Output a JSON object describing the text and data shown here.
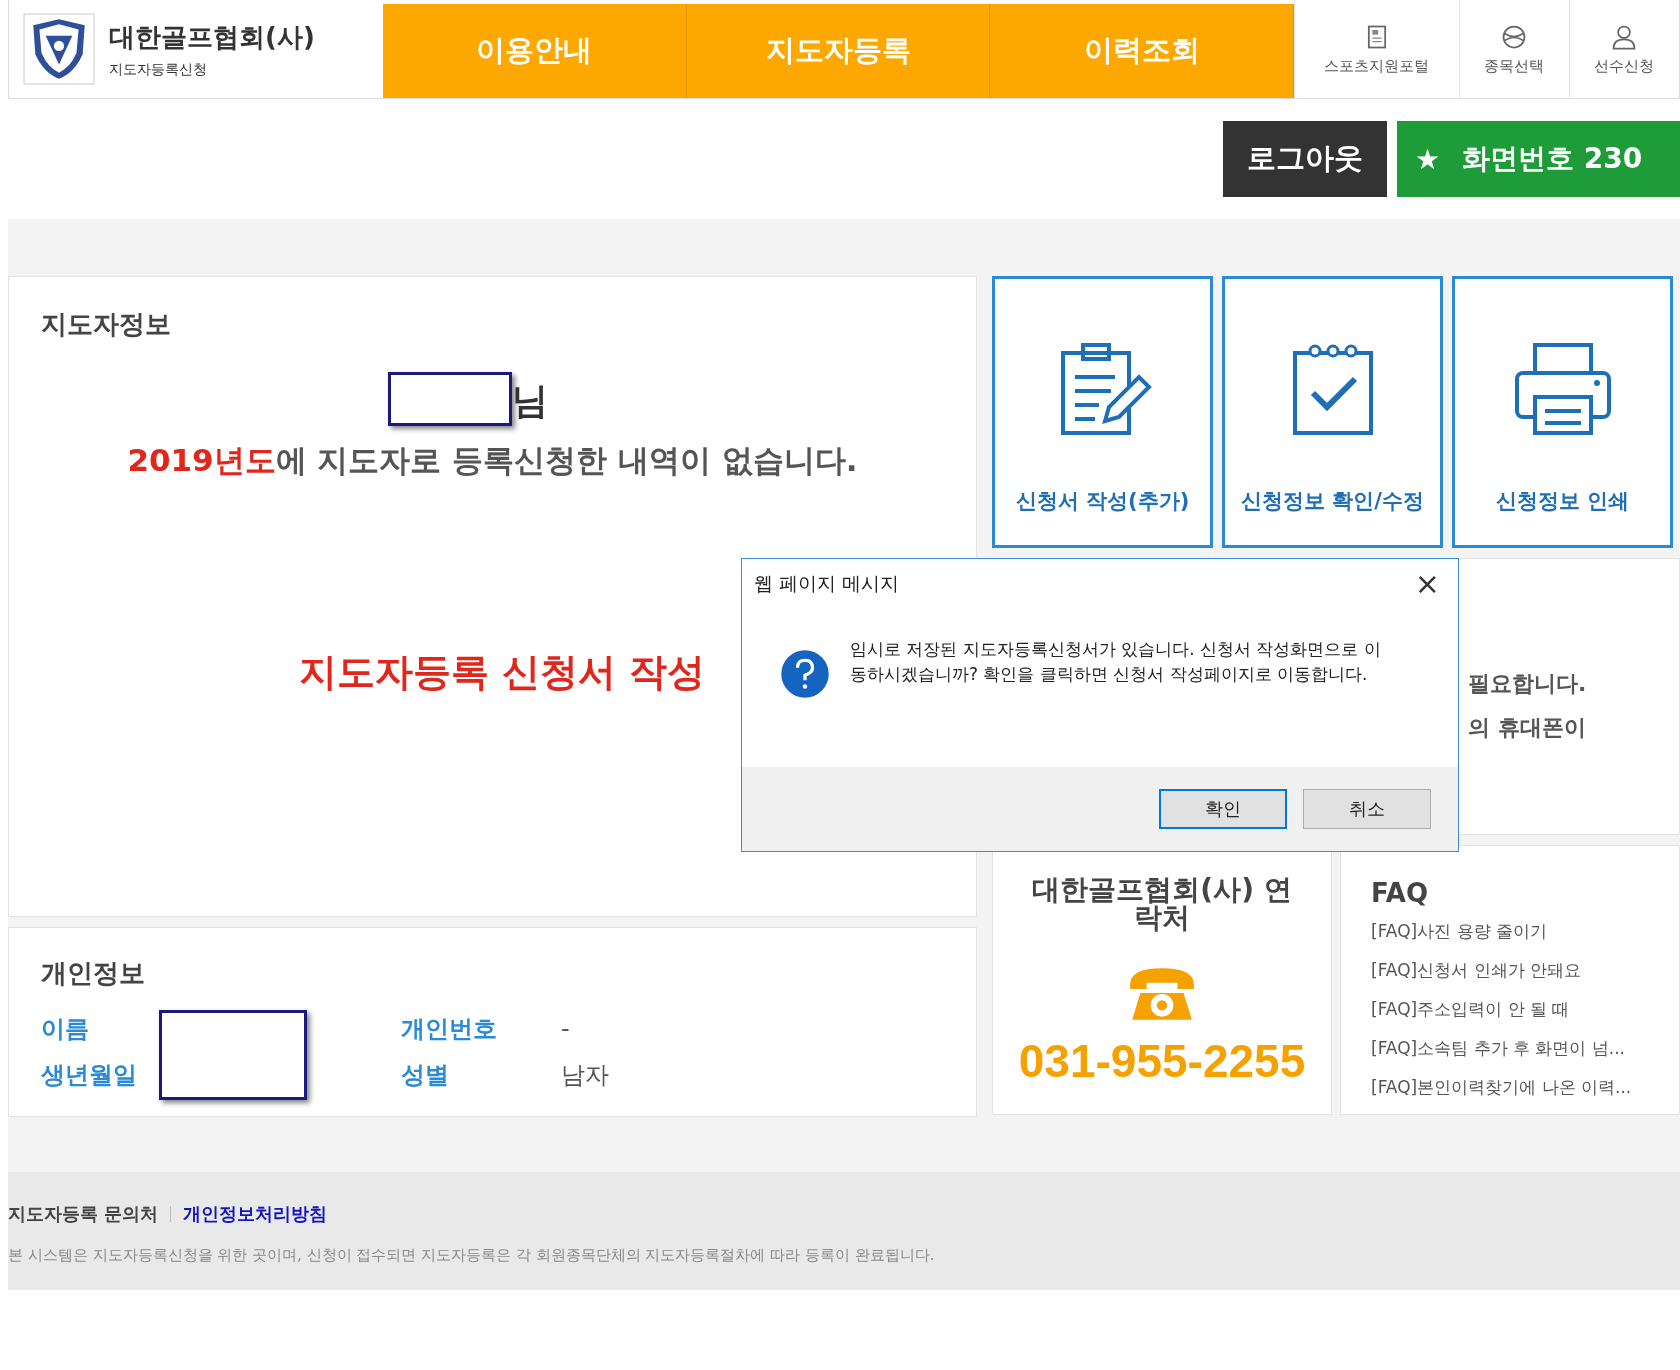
{
  "header": {
    "logo_title": "대한골프협회(사)",
    "logo_subtitle": "지도자등록신청",
    "nav": [
      {
        "label": "이용안내",
        "selected": false
      },
      {
        "label": "지도자등록",
        "selected": false
      },
      {
        "label": "이력조회",
        "selected": false
      }
    ],
    "utility_links": [
      {
        "label": "스포츠지원포털"
      },
      {
        "label": "종목선택"
      },
      {
        "label": "선수신청"
      }
    ]
  },
  "actions": {
    "logout": "로그아웃",
    "star": "★",
    "screen_number": "화면번호 230"
  },
  "coach_info": {
    "title": "지도자정보",
    "honorific": "님",
    "year": "2019년도",
    "message": "에 지도자로 등록신청한 내역이 없습니다.",
    "apply_link": "지도자등록 신청서 작성"
  },
  "personal_info": {
    "title": "개인정보",
    "fields": [
      {
        "label": "이름"
      },
      {
        "label": "개인번호",
        "value": "-"
      },
      {
        "label": "생년월일"
      },
      {
        "label": "성별",
        "value": "남자"
      }
    ]
  },
  "tiles": [
    {
      "label": "신청서 작성(추가)"
    },
    {
      "label": "신청정보 확인/수정"
    },
    {
      "label": "신청정보 인쇄"
    }
  ],
  "notice_fragments": [
    "필요합니다.",
    "의 휴대폰이"
  ],
  "contact": {
    "title": "대한골프협회(사) 연락처",
    "phone": "031-955-2255"
  },
  "faq": {
    "title": "FAQ",
    "items": [
      "[FAQ]사진 용량 줄이기",
      "[FAQ]신청서 인쇄가 안돼요",
      "[FAQ]주소입력이 안 될 때",
      "[FAQ]소속팀 추가 후 화면이 넘...",
      "[FAQ]본인이력찾기에 나온 이력..."
    ]
  },
  "footer": {
    "links": [
      {
        "label": "지도자등록 문의처",
        "emphasis": false
      },
      {
        "label": "개인정보처리방침",
        "emphasis": true
      }
    ],
    "notice": "본 시스템은 지도자등록신청을 위한 곳이며, 신청이 접수되면 지도자등록은 각 회원종목단체의 지도자등록절차에 따라 등록이 완료됩니다."
  },
  "dialog": {
    "title": "웹 페이지 메시지",
    "close": "×",
    "message": "임시로 저장된 지도자등록신청서가 있습니다. 신청서 작성화면으로 이동하시겠습니까? 확인을 클릭하면 신청서 작성페이지로 이동합니다.",
    "buttons": [
      {
        "label": "확인",
        "focused": true
      },
      {
        "label": "취소",
        "focused": false
      }
    ]
  }
}
